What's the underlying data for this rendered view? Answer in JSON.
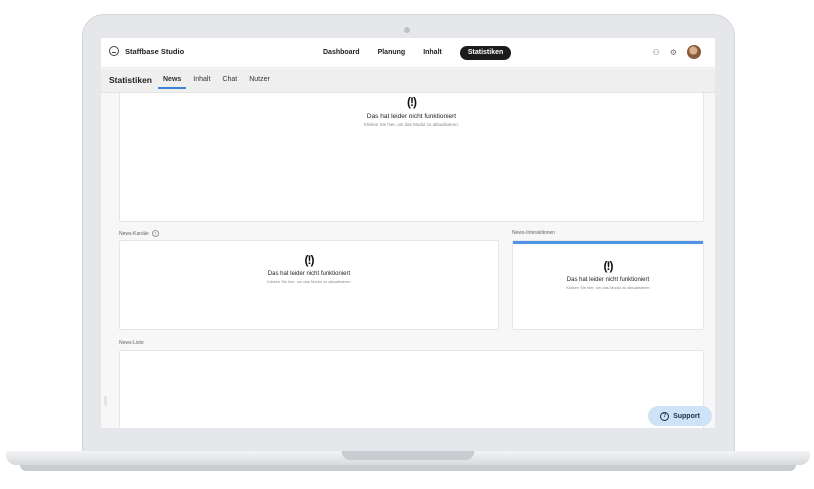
{
  "app": {
    "brand": "Staffbase Studio"
  },
  "topnav": {
    "items": [
      {
        "label": "Dashboard"
      },
      {
        "label": "Planung"
      },
      {
        "label": "Inhalt"
      },
      {
        "label": "Statistiken",
        "active": true
      }
    ]
  },
  "subnav": {
    "title": "Statistiken",
    "tabs": [
      {
        "label": "News",
        "active": true
      },
      {
        "label": "Inhalt"
      },
      {
        "label": "Chat"
      },
      {
        "label": "Nutzer"
      }
    ]
  },
  "error": {
    "icon_glyph": "(!)",
    "title": "Das hat leider nicht funktioniert",
    "sub_main": "Klicken Sie hier, um das Modul zu aktualisieren.",
    "sub_small": "Klicken Sie hier, um das Modul zu aktualisieren"
  },
  "sections": {
    "channels": "News-Kanäle",
    "interactions": "News-Interaktionen",
    "list": "News-Liste"
  },
  "support": {
    "label": "Support",
    "icon_glyph": "?"
  },
  "colors": {
    "accent": "#4f94e6",
    "nav_active_bg": "#1b1b1b",
    "support_bg": "#cfe3f8"
  }
}
